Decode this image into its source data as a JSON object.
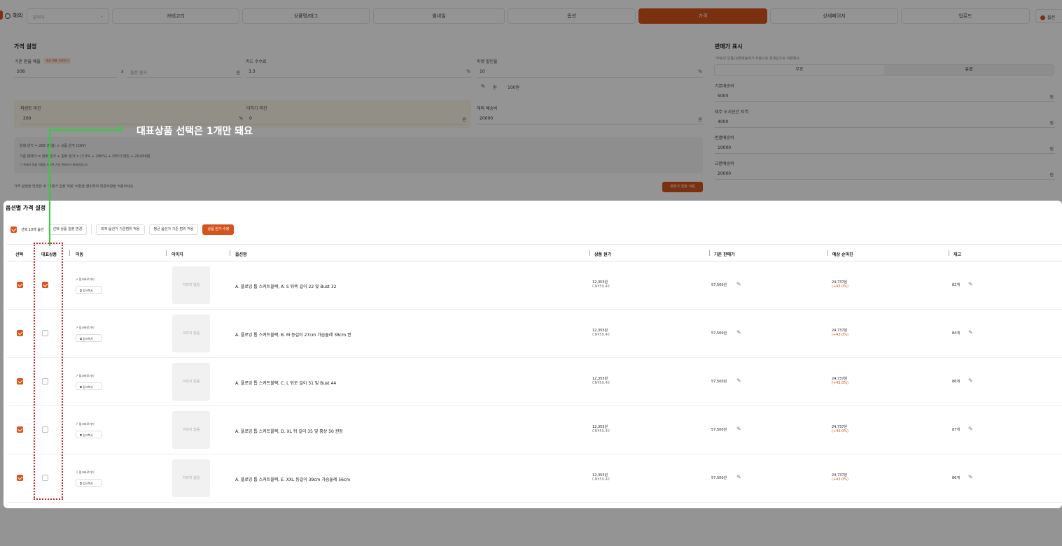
{
  "nav": {
    "overseas_label": "해외",
    "select_placeholder": "불러와",
    "tabs": [
      {
        "label": "카테고리",
        "active": false
      },
      {
        "label": "상품명/태그",
        "active": false
      },
      {
        "label": "썸네일",
        "active": false
      },
      {
        "label": "옵션",
        "active": false
      },
      {
        "label": "가격",
        "active": true
      },
      {
        "label": "상세페이지",
        "active": false
      },
      {
        "label": "업로드",
        "active": false
      }
    ],
    "option_btn": "옵션"
  },
  "price_settings": {
    "title": "가격 설정",
    "exchange_label": "기준 환율 배율",
    "exchange_badge": "최신 환율 가져오기",
    "exchange_value": "208",
    "times": "x",
    "original_placeholder": "옵션 원가",
    "won": "원",
    "card_fee_label": "카드 수수료",
    "card_fee_value": "3.3",
    "percent": "%",
    "market_discount_label": "마켓 할인율",
    "market_discount_value": "10",
    "pct_opt": "%",
    "won_opt": "원",
    "round_opt": "100원",
    "percent_margin_label": "퍼센트 마진",
    "percent_margin_value": "200",
    "plus_margin_label": "더하기 마진",
    "plus_margin_value": "0",
    "overseas_ship_label": "해외 배송비",
    "overseas_ship_value": "20000",
    "formula_line1": "원화 원가 =  208 (환율)  ×  상품 원가 (CNY)",
    "formula_line2": "기준 판매가 =  원화 원가  +  원화 원가  ×  (3.3% + 200%)  +  더하기 마진  +  20,000원",
    "formula_note": "ⓘ 판매가 일괄 적용을 누르면 기준 판매가가 재계산됩니다.",
    "note": "가격 설정을 변경한 후 '판매가 일괄 적용' 버튼을 클릭하여 변경사항을 적용하세요.",
    "apply_btn": "판매가 일괄 적용"
  },
  "sale_display": {
    "title": "판매가 표시",
    "subtitle": "*무료인 반품/교환배송비가 자동으로 최대값으로 적용돼요",
    "free": "무료",
    "paid": "유료",
    "fields": [
      {
        "label": "기본배송비",
        "value": "5000"
      },
      {
        "label": "제주 도서산간 지역",
        "value": "4000"
      },
      {
        "label": "반품배송비",
        "value": "10000"
      },
      {
        "label": "교환배송비",
        "value": "20000"
      }
    ],
    "won": "원"
  },
  "callout": "대표상품 선택은 1개만 돼요",
  "option_panel": {
    "title": "옵션별 가격 설정",
    "select_count": "선택 10개 옵션",
    "bulk_change": "선택 상품 일괄 변경",
    "min_apply": "최저 옵션가 기준범위 적용",
    "avg_apply": "평균 옵션가 기준 범위 적용",
    "edit_price": "상품 원가 수정",
    "headers": {
      "select": "선택",
      "rep": "대표상품",
      "move": "이동",
      "image": "이미지",
      "name": "옵션명",
      "cost": "상품 원가",
      "base_price": "기준 판매가",
      "margin": "예상 순마진",
      "stock": "재고"
    },
    "rows": [
      {
        "link": "링크바로가기",
        "copy": "링크복사",
        "noimg": "이미지 없음",
        "name": "A. 플로잉 톱 스커트블랙, A. S  뒤쪽 길이 22 및 Bust 32",
        "cost": "12,355원",
        "cny": "CN¥59.40",
        "price": "57,500원",
        "margin": "24,737원",
        "margin_pct": "(+43.0%)",
        "stock": "82개",
        "checked": true,
        "rep": true
      },
      {
        "link": "링크바로가기",
        "copy": "링크복사",
        "noimg": "이미지 없음",
        "name": "A. 플로잉 톱 스커트블랙, B. M 등길이 27cm 가슴둘레 38cm 권",
        "cost": "12,355원",
        "cny": "CN¥59.40",
        "price": "57,500원",
        "margin": "24,737원",
        "margin_pct": "(+43.0%)",
        "stock": "84개",
        "checked": true,
        "rep": false
      },
      {
        "link": "링크바로가기",
        "copy": "링크복사",
        "noimg": "이미지 없음",
        "name": "A. 플로잉 톱 스커트블랙, C. L  뒤로 길이 31 및 Bust 44",
        "cost": "12,355원",
        "cny": "CN¥59.40",
        "price": "57,500원",
        "margin": "24,737원",
        "margin_pct": "(+43.0%)",
        "stock": "86개",
        "checked": true,
        "rep": false
      },
      {
        "link": "링크바로가기",
        "copy": "링크복사",
        "noimg": "이미지 없음",
        "name": "A. 플로잉 톱 스커트블랙, D. XL  뒤 길이 35 및 흉상 50 권장",
        "cost": "12,355원",
        "cny": "CN¥59.40",
        "price": "57,500원",
        "margin": "24,737원",
        "margin_pct": "(+43.0%)",
        "stock": "87개",
        "checked": true,
        "rep": false
      },
      {
        "link": "링크바로가기",
        "copy": "링크복사",
        "noimg": "이미지 없음",
        "name": "A. 플로잉 톱 스커트블랙, E. XXL 등길이 39cm 가슴둘레 56cm",
        "cost": "12,355원",
        "cny": "CN¥59.40",
        "price": "57,500원",
        "margin": "24,737원",
        "margin_pct": "(+43.0%)",
        "stock": "86개",
        "checked": true,
        "rep": false
      }
    ]
  },
  "colors": {
    "accent": "#d4541d",
    "annotation_green": "#2ed03b",
    "annotation_red": "#d32020"
  }
}
